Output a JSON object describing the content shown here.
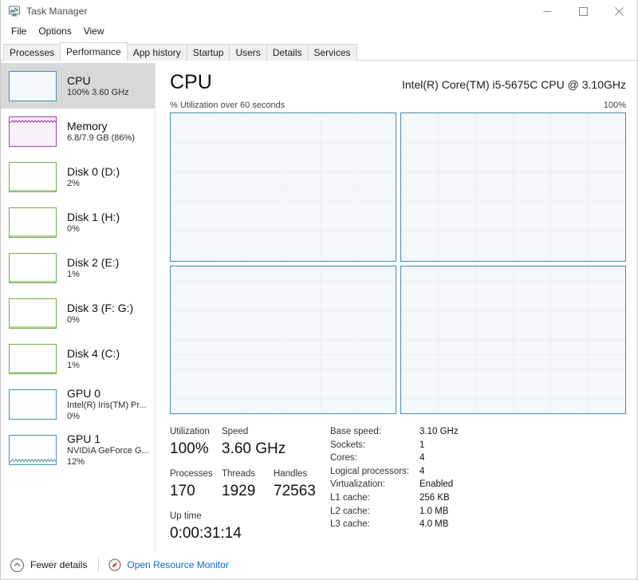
{
  "window": {
    "title": "Task Manager",
    "icon": "task-manager-icon",
    "controls": {
      "minimize": "minimize-icon",
      "maximize": "maximize-icon",
      "close": "close-icon"
    }
  },
  "menu": {
    "items": [
      {
        "label": "File"
      },
      {
        "label": "Options"
      },
      {
        "label": "View"
      }
    ]
  },
  "tabs": {
    "active": "Performance",
    "items": [
      {
        "label": "Processes"
      },
      {
        "label": "Performance"
      },
      {
        "label": "App history"
      },
      {
        "label": "Startup"
      },
      {
        "label": "Users"
      },
      {
        "label": "Details"
      },
      {
        "label": "Services"
      }
    ]
  },
  "sidebar": {
    "items": [
      {
        "title": "CPU",
        "sub": "100% 3.60 GHz",
        "sub2": "",
        "kind": "cpu",
        "selected": true,
        "accent": "#4a90ab"
      },
      {
        "title": "Memory",
        "sub": "6.8/7.9 GB (86%)",
        "sub2": "",
        "kind": "mem",
        "selected": false,
        "accent": "#a33fa3"
      },
      {
        "title": "Disk 0 (D:)",
        "sub": "2%",
        "sub2": "",
        "kind": "disk",
        "selected": false,
        "accent": "#76ab4a"
      },
      {
        "title": "Disk 1 (H:)",
        "sub": "0%",
        "sub2": "",
        "kind": "disk",
        "selected": false,
        "accent": "#76ab4a"
      },
      {
        "title": "Disk 2 (E:)",
        "sub": "1%",
        "sub2": "",
        "kind": "disk",
        "selected": false,
        "accent": "#76ab4a"
      },
      {
        "title": "Disk 3 (F: G:)",
        "sub": "0%",
        "sub2": "",
        "kind": "disk",
        "selected": false,
        "accent": "#76ab4a"
      },
      {
        "title": "Disk 4 (C:)",
        "sub": "1%",
        "sub2": "",
        "kind": "disk",
        "selected": false,
        "accent": "#76ab4a"
      },
      {
        "title": "GPU 0",
        "sub": "Intel(R) Iris(TM) Pr...",
        "sub2": "0%",
        "kind": "gpu",
        "selected": false,
        "accent": "#4a90ab"
      },
      {
        "title": "GPU 1",
        "sub": "NVIDIA GeForce G...",
        "sub2": "12%",
        "kind": "gpu",
        "selected": false,
        "accent": "#4a90ab"
      }
    ]
  },
  "panel": {
    "title": "CPU",
    "model": "Intel(R) Core(TM) i5-5675C CPU @ 3.10GHz",
    "graph_caption": "% Utilization over 60 seconds",
    "graph_max": "100%",
    "graph_panes": 4,
    "grid_columns": 6,
    "grid_rows": 10
  },
  "stats": {
    "primary": [
      {
        "label": "Utilization",
        "value": "100%"
      },
      {
        "label": "Speed",
        "value": "3.60 GHz"
      }
    ],
    "secondary": [
      {
        "label": "Processes",
        "value": "170"
      },
      {
        "label": "Threads",
        "value": "1929"
      },
      {
        "label": "Handles",
        "value": "72563"
      }
    ],
    "uptime": {
      "label": "Up time",
      "value": "0:00:31:14"
    },
    "info": [
      {
        "key": "Base speed:",
        "value": "3.10 GHz"
      },
      {
        "key": "Sockets:",
        "value": "1"
      },
      {
        "key": "Cores:",
        "value": "4"
      },
      {
        "key": "Logical processors:",
        "value": "4"
      },
      {
        "key": "Virtualization:",
        "value": "Enabled"
      },
      {
        "key": "L1 cache:",
        "value": "256 KB"
      },
      {
        "key": "L2 cache:",
        "value": "1.0 MB"
      },
      {
        "key": "L3 cache:",
        "value": "4.0 MB"
      }
    ]
  },
  "footer": {
    "fewer_details": "Fewer details",
    "fewer_icon": "chevron-up-icon",
    "resource_monitor": "Open Resource Monitor",
    "resource_monitor_icon": "resource-monitor-icon",
    "link_color": "#1166cc"
  }
}
